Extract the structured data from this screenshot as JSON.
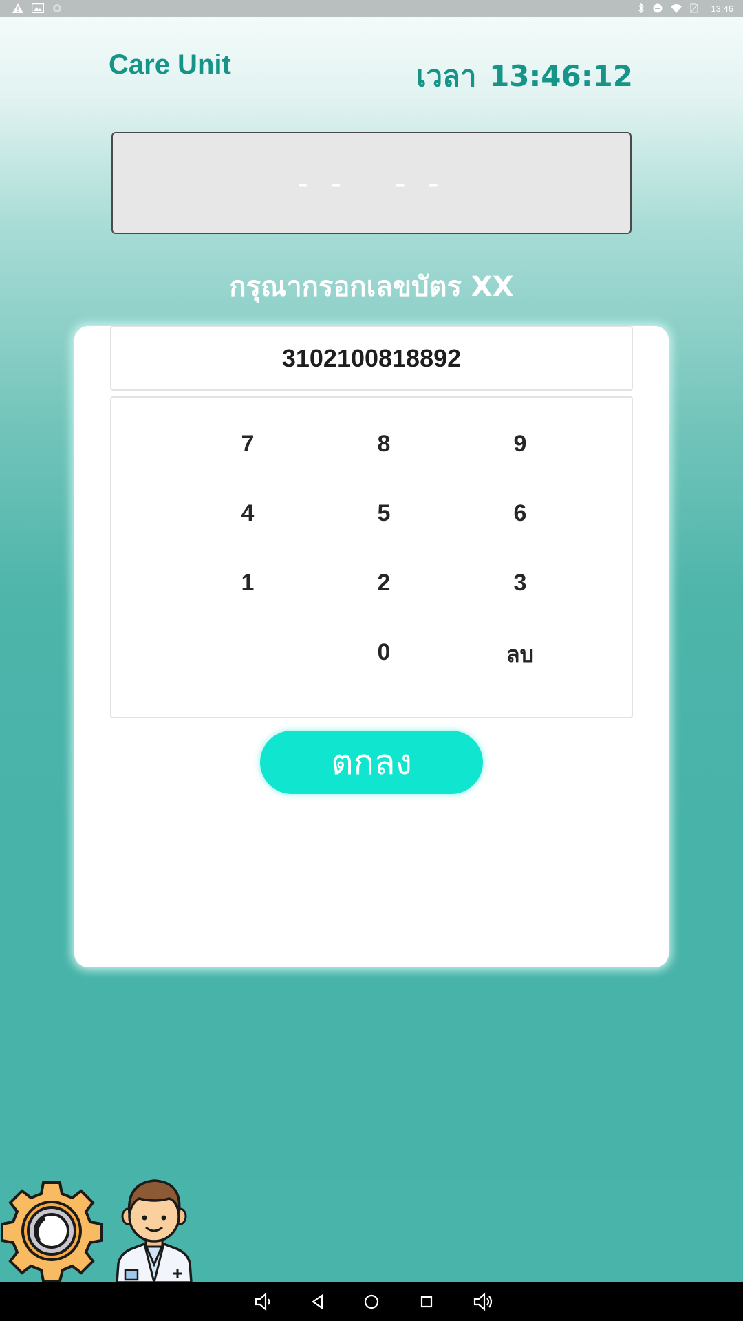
{
  "status_bar": {
    "time": "13:46",
    "left_icons": [
      "warning-icon",
      "gallery-icon",
      "sync-icon"
    ],
    "right_icons": [
      "bluetooth-icon",
      "dnd-icon",
      "wifi-icon",
      "no-sim-icon"
    ]
  },
  "header": {
    "title": "Care Unit",
    "clock_label": "เวลา",
    "clock_time": "13:46:12"
  },
  "queue_display": {
    "value": "- -   - -"
  },
  "instruction": "กรุณากรอกเลขบัตร XX",
  "id_input": {
    "value": "3102100818892"
  },
  "keypad": {
    "keys": [
      "7",
      "8",
      "9",
      "4",
      "5",
      "6",
      "1",
      "2",
      "3",
      "0",
      "ลบ"
    ]
  },
  "confirm_button": {
    "label": "ตกลง"
  },
  "bottom_icons": [
    "gear-icon",
    "doctor-icon"
  ],
  "nav_bar": [
    "volume-down-icon",
    "back-icon",
    "home-icon",
    "recents-icon",
    "volume-up-icon"
  ],
  "colors": {
    "accent": "#169488",
    "button": "#10e5cf",
    "background_bottom": "#48b3a9"
  }
}
